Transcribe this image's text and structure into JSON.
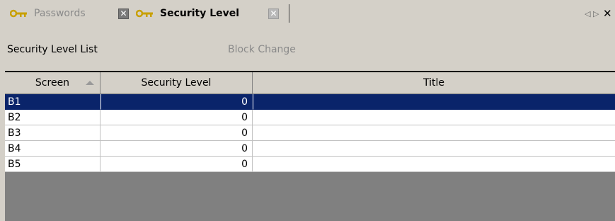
{
  "tabs": [
    {
      "label": "Passwords",
      "active": false,
      "icon": "key-icon"
    },
    {
      "label": "Security Level",
      "active": true,
      "icon": "key-icon"
    }
  ],
  "strip_controls": {
    "prev": "◁",
    "next": "▷",
    "close": "✕"
  },
  "toolbar": {
    "security_level_list": "Security Level List",
    "block_change": "Block Change"
  },
  "grid": {
    "columns": [
      "Screen",
      "Security Level",
      "Title"
    ],
    "sorted_column": "Screen",
    "sort_direction": "ascending",
    "rows": [
      {
        "screen": "B1",
        "level": "0",
        "title": "",
        "selected": true
      },
      {
        "screen": "B2",
        "level": "0",
        "title": "",
        "selected": false
      },
      {
        "screen": "B3",
        "level": "0",
        "title": "",
        "selected": false
      },
      {
        "screen": "B4",
        "level": "0",
        "title": "",
        "selected": false
      },
      {
        "screen": "B5",
        "level": "0",
        "title": "",
        "selected": false
      }
    ]
  },
  "colors": {
    "selection": "#0a246a",
    "panel": "#d4d0c8",
    "empty_area": "#808080",
    "key_icon": "#c8a000"
  }
}
